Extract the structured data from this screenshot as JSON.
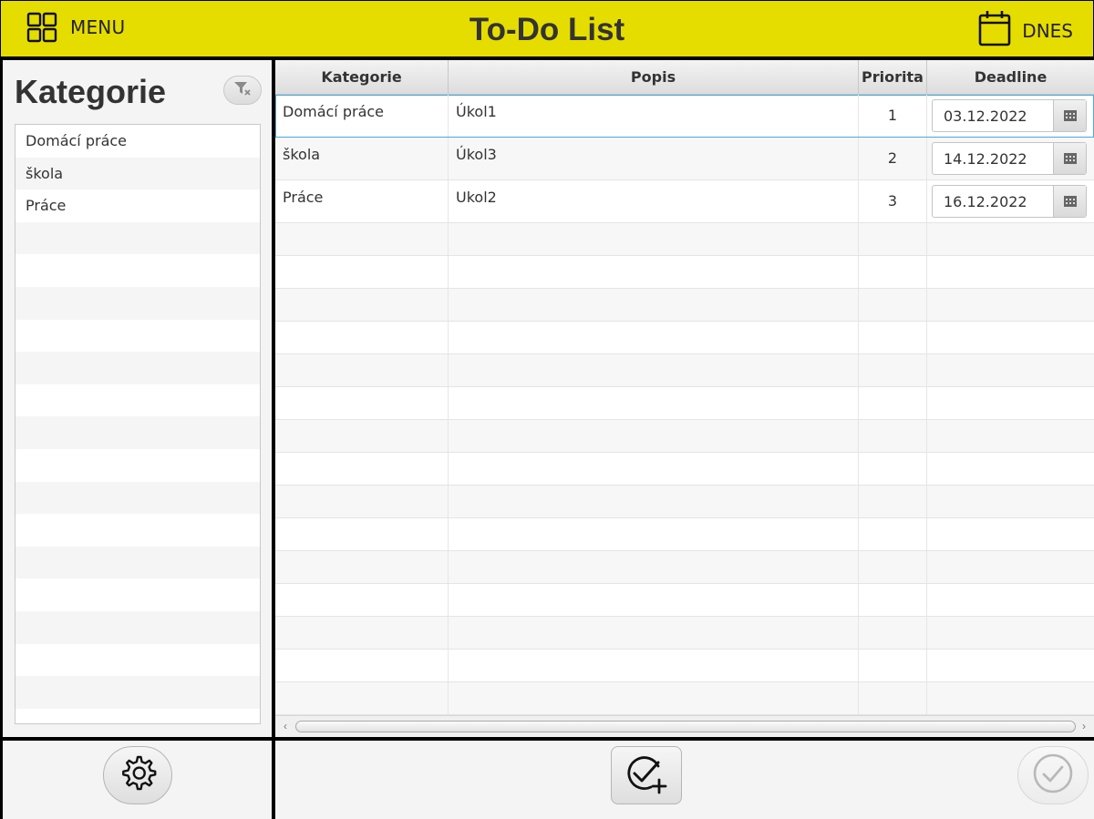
{
  "header": {
    "menu_label": "MENU",
    "title": "To-Do List",
    "today_label": "DNES"
  },
  "sidebar": {
    "title": "Kategorie",
    "filter_icon": "filter-clear-icon",
    "categories": [
      {
        "label": "Domácí práce"
      },
      {
        "label": "škola"
      },
      {
        "label": "Práce"
      }
    ]
  },
  "table": {
    "columns": {
      "kategorie": "Kategorie",
      "popis": "Popis",
      "priorita": "Priorita",
      "deadline": "Deadline"
    },
    "rows": [
      {
        "kategorie": "Domácí práce",
        "popis": "Úkol1",
        "priorita": "1",
        "deadline": "03.12.2022",
        "selected": true
      },
      {
        "kategorie": "škola",
        "popis": "Úkol3",
        "priorita": "2",
        "deadline": "14.12.2022",
        "selected": false
      },
      {
        "kategorie": "Práce",
        "popis": "Ukol2",
        "priorita": "3",
        "deadline": "16.12.2022",
        "selected": false
      }
    ]
  },
  "footer": {
    "settings_icon": "gear-icon",
    "add_icon": "check-circle-plus-icon",
    "done_icon": "check-circle-icon"
  },
  "colors": {
    "header_bg": "#e6dd00",
    "selection_outline": "#4aa8d8"
  }
}
